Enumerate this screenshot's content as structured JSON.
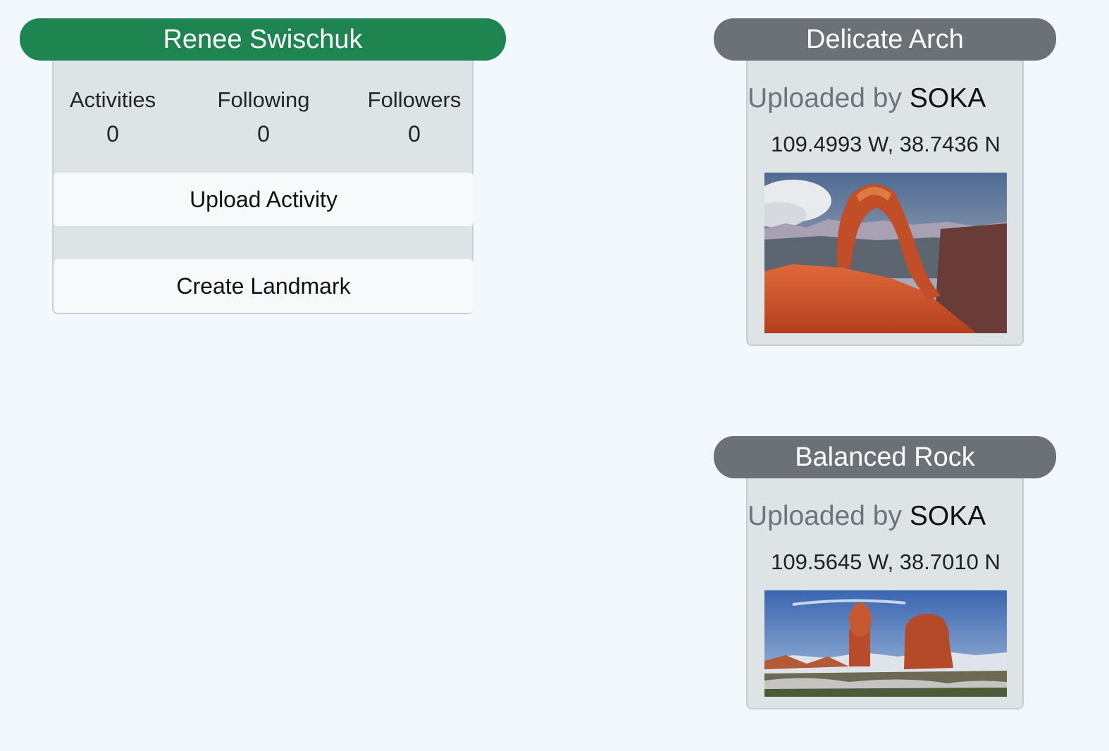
{
  "profile": {
    "name": "Renee Swischuk",
    "stats": [
      {
        "label": "Activities",
        "value": "0"
      },
      {
        "label": "Following",
        "value": "0"
      },
      {
        "label": "Followers",
        "value": "0"
      }
    ],
    "upload_label": "Upload Activity",
    "create_label": "Create Landmark"
  },
  "landmarks": [
    {
      "title": "Delicate Arch",
      "uploaded_prefix": "Uploaded by",
      "uploader": "SOKA",
      "coords": "109.4993 W, 38.7436 N",
      "image": "delicate-arch-photo"
    },
    {
      "title": "Balanced Rock",
      "uploaded_prefix": "Uploaded by",
      "uploader": "SOKA",
      "coords": "109.5645 W, 38.7010 N",
      "image": "balanced-rock-photo"
    }
  ],
  "colors": {
    "profile_header": "#1f8550",
    "landmark_header": "#6b7177",
    "background": "#f2f8fe",
    "panel": "#dee4e5"
  }
}
